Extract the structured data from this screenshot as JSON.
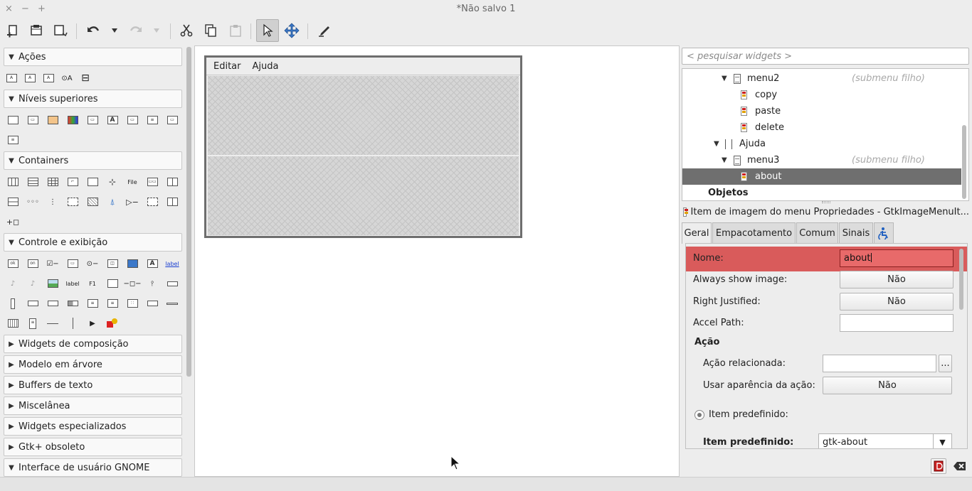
{
  "window": {
    "title": "*Não salvo 1",
    "controls": {
      "close": "×",
      "minimize": "−",
      "maximize": "+"
    }
  },
  "toolbar": {
    "items": [
      "new-icon",
      "open-icon",
      "save-icon",
      "undo-icon",
      "undo-dropdown-icon",
      "redo-icon",
      "redo-dropdown-icon",
      "cut-icon",
      "copy-icon",
      "paste-icon",
      "pointer-icon",
      "drag-resize-icon",
      "edit-icon"
    ]
  },
  "palette": {
    "categories": [
      {
        "label": "Ações",
        "expanded": true
      },
      {
        "label": "Níveis superiores",
        "expanded": true
      },
      {
        "label": "Containers",
        "expanded": true
      },
      {
        "label": "Controle e exibição",
        "expanded": true
      },
      {
        "label": "Widgets de composição",
        "expanded": false
      },
      {
        "label": "Modelo em árvore",
        "expanded": false
      },
      {
        "label": "Buffers de texto",
        "expanded": false
      },
      {
        "label": "Miscelânea",
        "expanded": false
      },
      {
        "label": "Widgets especializados",
        "expanded": false
      },
      {
        "label": "Gtk+ obsoleto",
        "expanded": false
      },
      {
        "label": "Interface de usuário GNOME",
        "expanded": true
      }
    ],
    "widget_texts": {
      "file": "File",
      "label": "label",
      "ok": "ok",
      "on": "on",
      "f1": "F1"
    }
  },
  "design": {
    "menubar": [
      "Editar",
      "Ajuda"
    ]
  },
  "inspector": {
    "search_placeholder": "< pesquisar widgets >",
    "tree": [
      {
        "label": "menu2",
        "sub": "(submenu filho)",
        "icon": "menu-icon",
        "expanded": true
      },
      {
        "label": "copy",
        "sub": "",
        "icon": "menu-item-icon"
      },
      {
        "label": "paste",
        "sub": "",
        "icon": "menu-item-icon"
      },
      {
        "label": "delete",
        "sub": "",
        "icon": "menu-item-icon"
      },
      {
        "label": "Ajuda",
        "sub": "",
        "icon": "menubar-item-icon",
        "expanded": true
      },
      {
        "label": "menu3",
        "sub": "(submenu filho)",
        "icon": "menu-icon",
        "expanded": true
      },
      {
        "label": "about",
        "sub": "",
        "icon": "menu-item-icon",
        "selected": true
      }
    ],
    "objects_label": "Objetos"
  },
  "properties": {
    "header": "Item de imagem do menu Propriedades - GtkImageMenuIt...",
    "tabs": [
      "Geral",
      "Empacotamento",
      "Comum",
      "Sinais"
    ],
    "active_tab": "Geral",
    "name_label": "Nome:",
    "name_value": "about",
    "always_show_image_label": "Always show image:",
    "always_show_image_value": "Não",
    "right_justified_label": "Right Justified:",
    "right_justified_value": "Não",
    "accel_path_label": "Accel Path:",
    "accel_path_value": "",
    "action_section": "Ação",
    "related_action_label": "Ação relacionada:",
    "related_action_value": "",
    "related_action_button": "...",
    "use_action_appearance_label": "Usar aparência da ação:",
    "use_action_appearance_value": "Não",
    "stock_item_radio_label": "Item predefinido:",
    "stock_item_label": "Item predefinido:",
    "stock_item_value": "gtk-about"
  },
  "colors": {
    "highlight": "#d95b5b",
    "selection": "#6f6f6f"
  }
}
